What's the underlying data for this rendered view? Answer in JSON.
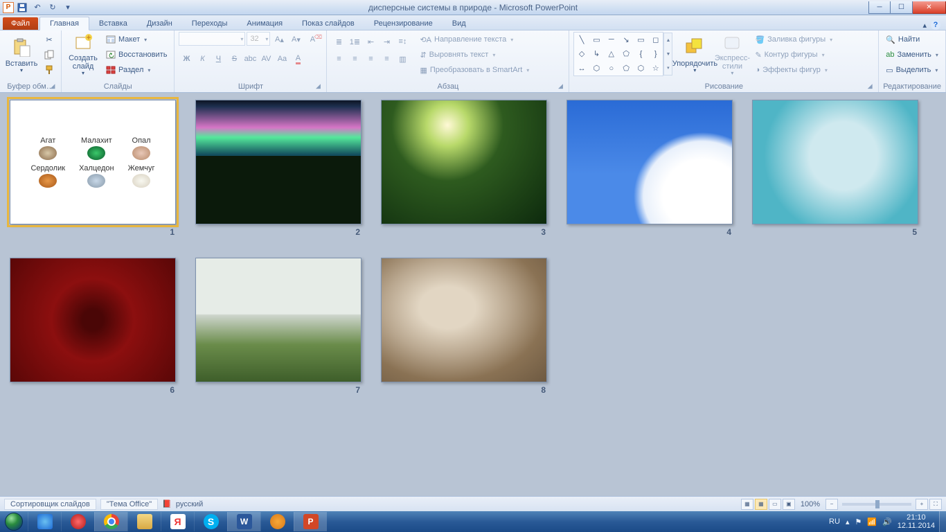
{
  "title": "дисперсные системы в природе  -  Microsoft PowerPoint",
  "tabs": {
    "file": "Файл",
    "home": "Главная",
    "insert": "Вставка",
    "design": "Дизайн",
    "transitions": "Переходы",
    "animation": "Анимация",
    "slideshow": "Показ слайдов",
    "review": "Рецензирование",
    "view": "Вид"
  },
  "groups": {
    "clipboard": "Буфер обм…",
    "slides": "Слайды",
    "font": "Шрифт",
    "paragraph": "Абзац",
    "drawing": "Рисование",
    "editing": "Редактирование"
  },
  "clipboard": {
    "paste": "Вставить"
  },
  "slidesGroup": {
    "new": "Создать слайд",
    "layout": "Макет",
    "reset": "Восстановить",
    "section": "Раздел"
  },
  "font": {
    "size": "32"
  },
  "paragraphGroup": {
    "textdir": "Направление текста",
    "align": "Выровнять текст",
    "smartart": "Преобразовать в SmartArt"
  },
  "drawing": {
    "arrange": "Упорядочить",
    "quick": "Экспресс-стили",
    "fill": "Заливка фигуры",
    "outline": "Контур фигуры",
    "effects": "Эффекты фигур"
  },
  "editing": {
    "find": "Найти",
    "replace": "Заменить",
    "select": "Выделить"
  },
  "slide1": {
    "g1": "Агат",
    "g2": "Малахит",
    "g3": "Опал",
    "g4": "Сердолик",
    "g5": "Халцедон",
    "g6": "Жемчуг"
  },
  "slidenums": [
    "1",
    "2",
    "3",
    "4",
    "5",
    "6",
    "7",
    "8"
  ],
  "status": {
    "view": "Сортировщик слайдов",
    "theme": "Тема Office",
    "lang": "русский",
    "zoom": "100%"
  },
  "tray": {
    "kbd": "RU",
    "time": "21:10",
    "date": "12.11.2014"
  }
}
